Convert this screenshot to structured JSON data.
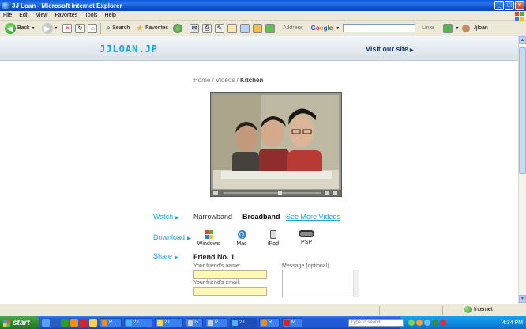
{
  "window": {
    "title": "JJ Loan - Microsoft Internet Explorer"
  },
  "menu": [
    "File",
    "Edit",
    "View",
    "Favorites",
    "Tools",
    "Help"
  ],
  "toolbar": {
    "back": "Back",
    "search": "Search",
    "favorites": "Favorites",
    "address_label": "Address",
    "google_letters": [
      "G",
      "o",
      "o",
      "g",
      "l",
      "e"
    ],
    "links": "Links",
    "user": "Jjloan"
  },
  "site": {
    "logo": "JJLOAN.JP",
    "visit": "Visit our site"
  },
  "breadcrumb": {
    "home": "Home",
    "sep": " / ",
    "videos": "Videos",
    "current": "Kitchen"
  },
  "watch": {
    "label": "Watch",
    "narrowband": "Narrowband",
    "broadband": "Broadband",
    "more": "See More Videos"
  },
  "download": {
    "label": "Download",
    "items": [
      "Windows",
      "Mac",
      "iPod",
      "PSP"
    ]
  },
  "share": {
    "label": "Share",
    "friend_title": "Friend No. 1",
    "name_label": "Your friend's name:",
    "email_label": "Your friend's email:",
    "message_label": "Message (optional)"
  },
  "statusbar": {
    "zone": "Internet"
  },
  "taskbar": {
    "start": "start",
    "tasks": [
      "R...",
      "2 I...",
      "2 I...",
      "G...",
      "P...",
      "2 I...",
      "R...",
      "M..."
    ],
    "search_placeholder": "Type to search",
    "clock": "4:34 PM"
  }
}
